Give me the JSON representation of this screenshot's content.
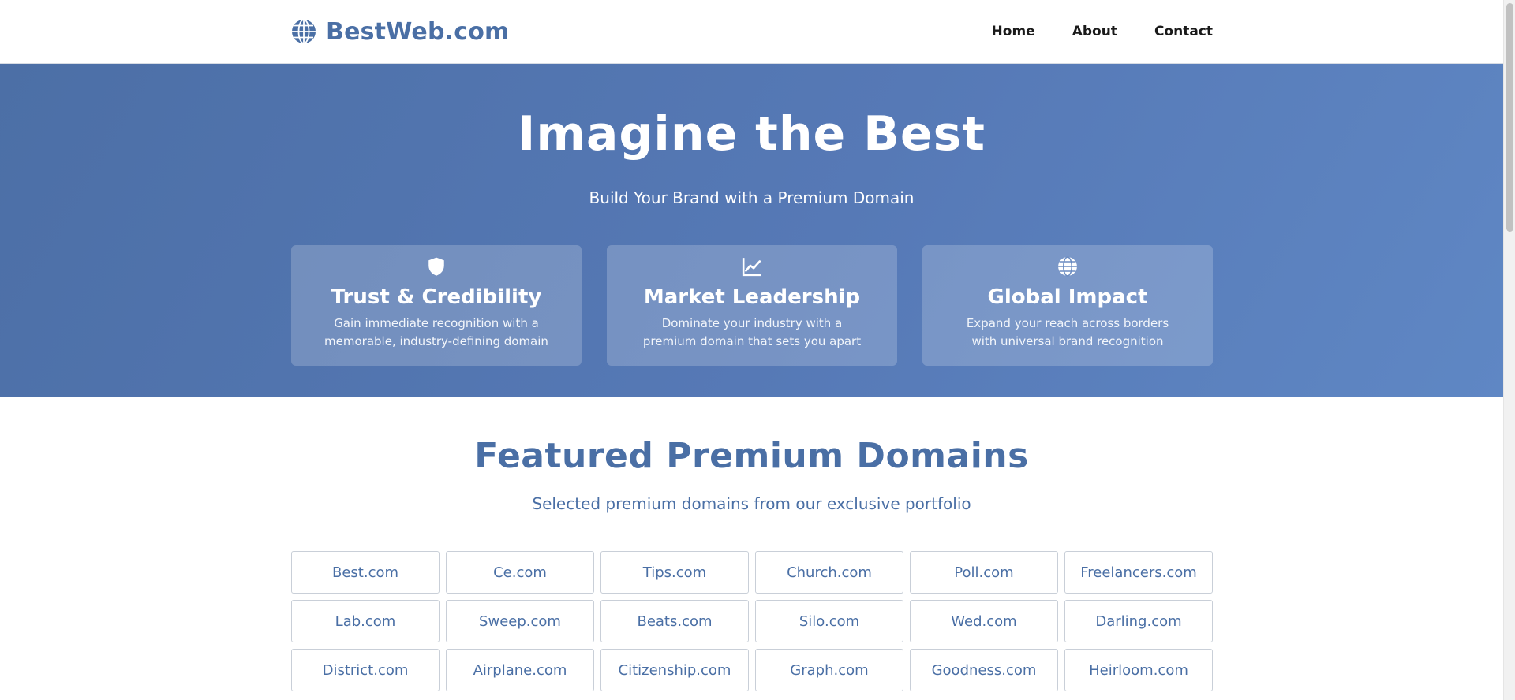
{
  "header": {
    "brand_name": "BestWeb.com",
    "brand_icon": "globe-icon",
    "nav": [
      {
        "label": "Home"
      },
      {
        "label": "About"
      },
      {
        "label": "Contact"
      }
    ]
  },
  "hero": {
    "title": "Imagine the Best",
    "subtitle": "Build Your Brand with a Premium Domain",
    "features": [
      {
        "icon": "shield-icon",
        "title": "Trust & Credibility",
        "description": "Gain immediate recognition with a memorable, industry-defining domain"
      },
      {
        "icon": "chart-line-icon",
        "title": "Market Leadership",
        "description": "Dominate your industry with a premium domain that sets you apart"
      },
      {
        "icon": "globe-icon",
        "title": "Global Impact",
        "description": "Expand your reach across borders with universal brand recognition"
      }
    ]
  },
  "featured": {
    "title": "Featured Premium Domains",
    "subtitle": "Selected premium domains from our exclusive portfolio",
    "domains": [
      "Best.com",
      "Ce.com",
      "Tips.com",
      "Church.com",
      "Poll.com",
      "Freelancers.com",
      "Lab.com",
      "Sweep.com",
      "Beats.com",
      "Silo.com",
      "Wed.com",
      "Darling.com",
      "District.com",
      "Airplane.com",
      "Citizenship.com",
      "Graph.com",
      "Goodness.com",
      "Heirloom.com"
    ]
  },
  "colors": {
    "brand": "#4a6fa5",
    "hero_start": "#4c6fa6",
    "hero_end": "#5f87c4"
  }
}
